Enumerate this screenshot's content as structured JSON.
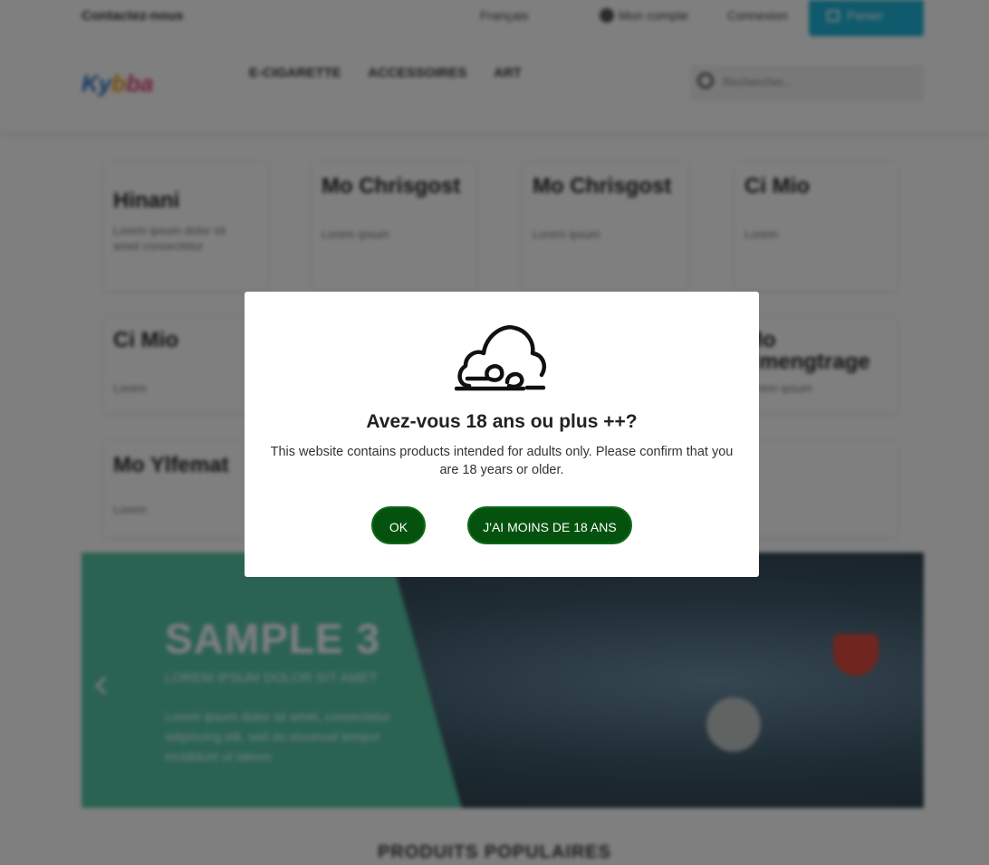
{
  "topbar": {
    "contact": "Contactez-nous",
    "language": "Français",
    "account": "Mon compte",
    "login": "Connexion",
    "cart": "Panier"
  },
  "header": {
    "logo": {
      "part1": "Ky",
      "part2": "b",
      "part3": "ba"
    },
    "nav": [
      "E-CIGARETTE",
      "ACCESSOIRES",
      "ART"
    ],
    "search_placeholder": "Rechercher..."
  },
  "tiles": [
    {
      "title": "Hinani",
      "desc": "Lorem ipsum dolor sit amet consectetur"
    },
    {
      "title": "Mo Chrisgost",
      "desc": "Lorem ipsum"
    },
    {
      "title": "Mo Chrisgost",
      "desc": "Lorem ipsum"
    },
    {
      "title": "Ci Mio",
      "desc": "Lorem"
    },
    {
      "title": "Ci Mio",
      "desc": "Lorem"
    },
    {
      "title": "Mo Ymengtrage",
      "desc": "Lorem ipsum"
    },
    {
      "title": "Mo Ylfemat",
      "desc": "Lorem"
    }
  ],
  "banner": {
    "headline": "SAMPLE 3",
    "subtitle": "LOREM IPSUM DOLOR SIT AMET",
    "paragraph": "Lorem ipsum dolor sit amet, consectetur adipiscing elit, sed do eiusmod tempor incididunt ut labore",
    "colors": {
      "panel": "#56c6a7"
    }
  },
  "section_title": "PRODUITS POPULAIRES",
  "modal": {
    "icon": "cloud-wind-icon",
    "title": "Avez-vous 18 ans ou plus ++?",
    "text": "This website contains products intended for adults only. Please confirm that you are 18 years or older.",
    "ok_label": "OK",
    "under_label": "J'AI MOINS DE 18 ANS",
    "colors": {
      "button": "#05520e"
    }
  }
}
